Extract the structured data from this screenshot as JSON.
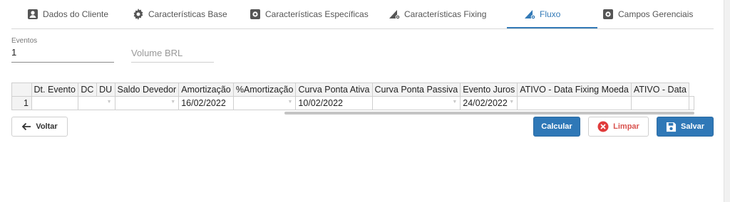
{
  "tabs": [
    {
      "label": "Dados do Cliente",
      "icon": "user-card-icon",
      "active": false
    },
    {
      "label": "Características Base",
      "icon": "gear-icon",
      "active": false
    },
    {
      "label": "Características Específicas",
      "icon": "gear-box-icon",
      "active": false
    },
    {
      "label": "Características Fixing",
      "icon": "chart-gear-icon",
      "active": false
    },
    {
      "label": "Fluxo",
      "icon": "chart-gear-icon",
      "active": true
    },
    {
      "label": "Campos Gerenciais",
      "icon": "gear-box-icon",
      "active": false
    }
  ],
  "form": {
    "eventos_label": "Eventos",
    "eventos_value": "1",
    "volume_placeholder": "Volume BRL"
  },
  "grid": {
    "columns": [
      "Dt. Evento",
      "DC",
      "DU",
      "Saldo Devedor",
      "Amortização",
      "%Amortização",
      "Curva Ponta Ativa",
      "Curva Ponta Passiva",
      "Evento Juros",
      "ATIVO - Data Fixing Moeda",
      "ATIVO - Data"
    ],
    "rows": [
      {
        "num": "1",
        "cells": [
          "",
          "",
          "",
          "",
          "16/02/2022",
          "",
          "10/02/2022",
          "",
          "24/02/2022",
          "",
          "",
          "",
          ""
        ]
      }
    ]
  },
  "buttons": {
    "voltar": "Voltar",
    "calcular": "Calcular",
    "limpar": "Limpar",
    "salvar": "Salvar"
  },
  "colors": {
    "primary": "#2f78b7",
    "active_tab": "#337ab7",
    "danger": "#d9534f"
  }
}
